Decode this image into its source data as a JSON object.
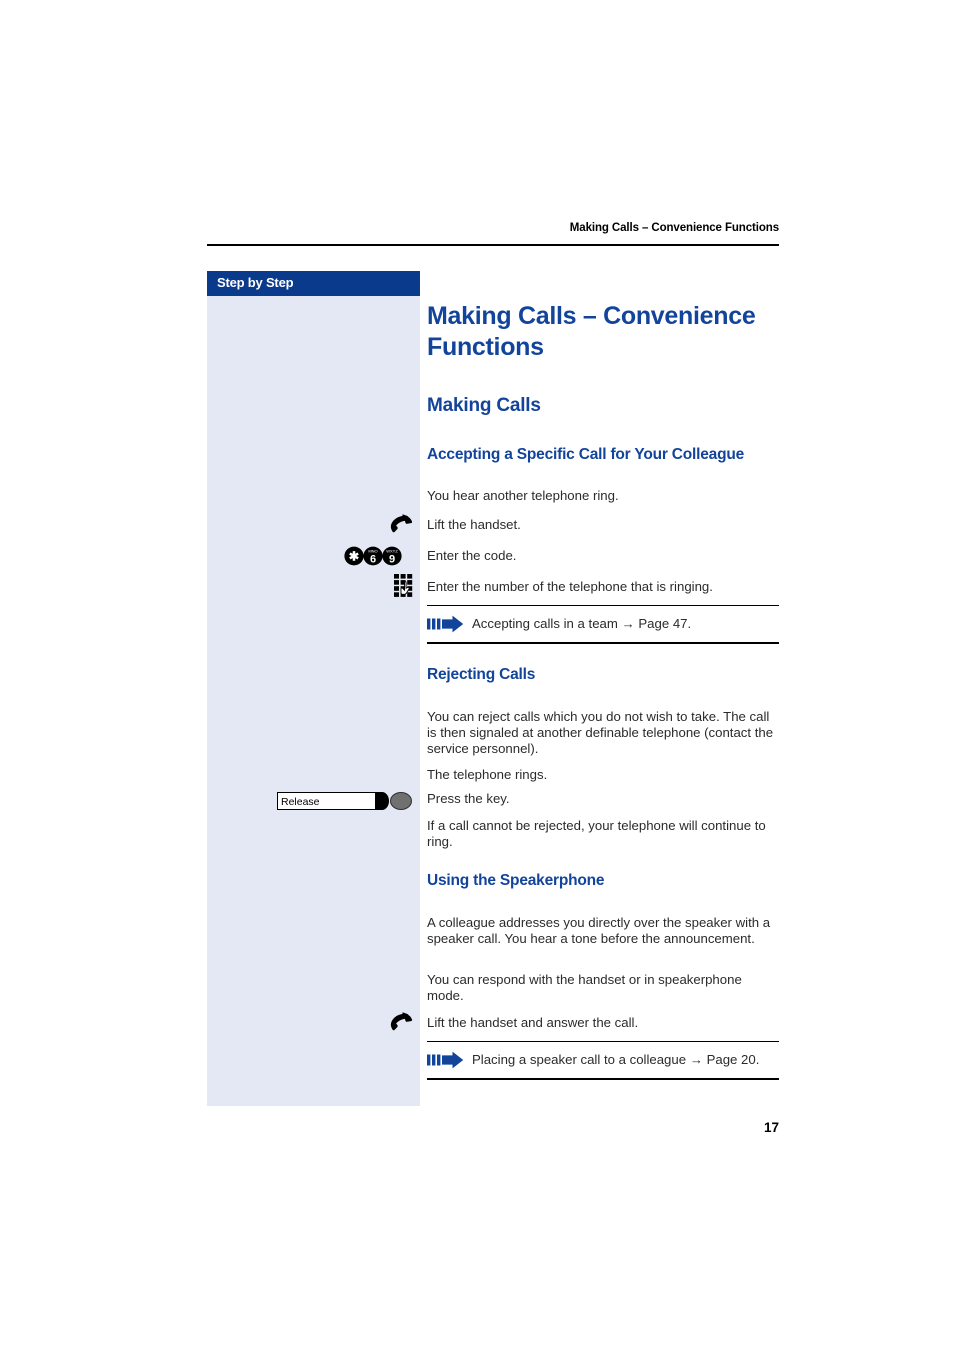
{
  "running_head": "Making Calls – Convenience Functions",
  "sidebar": {
    "header_label": "Step by Step",
    "release_key": {
      "label": "Release",
      "icon": "release-key-icon"
    }
  },
  "content": {
    "doc_title": "Making Calls – Convenience Functions",
    "section_title": "Making Calls",
    "subsections": [
      {
        "title": "Accepting a Specific Call for Your Colleague",
        "intro": "You hear another telephone ring.",
        "steps": [
          {
            "icon": "lift-handset-icon",
            "text": "Lift the handset."
          },
          {
            "icon": "dial-code-keys-icon",
            "keys": [
              "✱",
              "6",
              "9"
            ],
            "text": "Enter the code."
          },
          {
            "icon": "keypad-icon",
            "text": "Enter the number of the telephone that is ringing."
          }
        ],
        "xref": {
          "icon": "cross-reference-arrow-icon",
          "text": "Accepting calls in a team → Page 47."
        }
      },
      {
        "title": "Rejecting Calls",
        "paragraphs": [
          "You can reject calls which you do not wish to take. The call is then signaled at another definable telephone (contact the service personnel).",
          "The telephone rings.",
          "Press the key.",
          "If a call cannot be rejected, your telephone will continue to ring."
        ]
      },
      {
        "title": "Using the Speakerphone",
        "paragraphs": [
          "A colleague addresses you directly over the speaker with a speaker call. You hear a tone before the announcement.",
          "You can respond with the handset or in speakerphone mode."
        ],
        "steps": [
          {
            "icon": "lift-handset-icon",
            "text": "Lift the handset and answer the call."
          }
        ],
        "xref": {
          "icon": "cross-reference-arrow-icon",
          "text": "Placing a speaker call to a colleague → Page 20."
        }
      }
    ]
  },
  "footer": {
    "page_number": "17"
  },
  "colors": {
    "heading_blue": "#12449b",
    "sidebar_header_blue": "#0a3a8c",
    "sidebar_panel": "#e4e8f4",
    "arrow_blue": "#12449b",
    "body_text": "#2b2b2b"
  }
}
